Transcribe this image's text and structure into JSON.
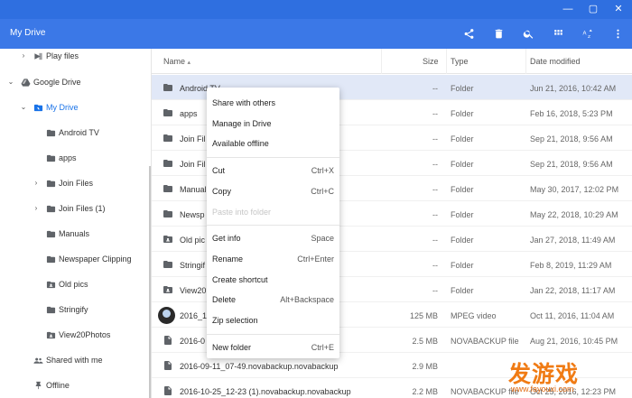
{
  "window": {
    "controls": [
      {
        "name": "minimize-button",
        "glyph": "—"
      },
      {
        "name": "maximize-button",
        "glyph": "▢"
      },
      {
        "name": "close-button",
        "glyph": "✕"
      }
    ]
  },
  "appbar": {
    "title": "My Drive",
    "icons": [
      "share-icon",
      "delete-icon",
      "search-icon",
      "grid-view-icon",
      "sort-az-icon",
      "more-vert-icon"
    ],
    "background": "#3b78e7"
  },
  "sidebar": {
    "items": [
      {
        "label": "Play files",
        "icon": "play-files-icon",
        "chevron": "›",
        "name": "sidebar-item-play-files"
      },
      {
        "label": "Google Drive",
        "icon": "google-drive-icon",
        "chevron": "⌄",
        "name": "sidebar-item-google-drive"
      },
      {
        "label": "My Drive",
        "icon": "my-drive-icon",
        "chevron": "⌄",
        "name": "sidebar-item-my-drive",
        "selected": true
      },
      {
        "label": "Android TV",
        "icon": "folder-icon",
        "chevron": "",
        "name": "sidebar-item-android-tv"
      },
      {
        "label": "apps",
        "icon": "folder-icon",
        "chevron": "",
        "name": "sidebar-item-apps"
      },
      {
        "label": "Join Files",
        "icon": "folder-icon",
        "chevron": "›",
        "name": "sidebar-item-join-files"
      },
      {
        "label": "Join Files (1)",
        "icon": "folder-icon",
        "chevron": "›",
        "name": "sidebar-item-join-files-1"
      },
      {
        "label": "Manuals",
        "icon": "folder-icon",
        "chevron": "",
        "name": "sidebar-item-manuals"
      },
      {
        "label": "Newspaper Clipping",
        "icon": "folder-icon",
        "chevron": "",
        "name": "sidebar-item-newspaper-clipping"
      },
      {
        "label": "Old pics",
        "icon": "shared-folder-icon",
        "chevron": "",
        "name": "sidebar-item-old-pics"
      },
      {
        "label": "Stringify",
        "icon": "folder-icon",
        "chevron": "",
        "name": "sidebar-item-stringify"
      },
      {
        "label": "View20Photos",
        "icon": "shared-folder-icon",
        "chevron": "",
        "name": "sidebar-item-view20photos"
      },
      {
        "label": "Shared with me",
        "icon": "shared-with-me-icon",
        "chevron": "",
        "name": "sidebar-item-shared-with-me"
      },
      {
        "label": "Offline",
        "icon": "offline-pin-icon",
        "chevron": "",
        "name": "sidebar-item-offline"
      }
    ]
  },
  "columns": {
    "name": "Name",
    "name_sort": "▴",
    "size": "Size",
    "type": "Type",
    "date": "Date modified"
  },
  "files": [
    {
      "name": "Android TV",
      "size": "--",
      "type": "Folder",
      "date": "Jun 21, 2016, 10:42 AM",
      "icon": "folder-icon",
      "selected": true
    },
    {
      "name": "apps",
      "size": "--",
      "type": "Folder",
      "date": "Feb 16, 2018, 5:23 PM",
      "icon": "folder-icon"
    },
    {
      "name": "Join Fil",
      "size": "--",
      "type": "Folder",
      "date": "Sep 21, 2018, 9:56 AM",
      "icon": "folder-icon"
    },
    {
      "name": "Join Fil",
      "size": "--",
      "type": "Folder",
      "date": "Sep 21, 2018, 9:56 AM",
      "icon": "folder-icon"
    },
    {
      "name": "Manual",
      "size": "--",
      "type": "Folder",
      "date": "May 30, 2017, 12:02 PM",
      "icon": "folder-icon"
    },
    {
      "name": "Newsp",
      "size": "--",
      "type": "Folder",
      "date": "May 22, 2018, 10:29 AM",
      "icon": "folder-icon"
    },
    {
      "name": "Old pic",
      "size": "--",
      "type": "Folder",
      "date": "Jan 27, 2018, 11:49 AM",
      "icon": "shared-folder-icon"
    },
    {
      "name": "Stringif",
      "size": "--",
      "type": "Folder",
      "date": "Feb 8, 2019, 11:29 AM",
      "icon": "folder-icon"
    },
    {
      "name": "View20",
      "size": "--",
      "type": "Folder",
      "date": "Jan 22, 2018, 11:17 AM",
      "icon": "shared-folder-icon"
    },
    {
      "name": "2016_1",
      "size": "125 MB",
      "type": "MPEG video",
      "date": "Oct 11, 2016, 11:04 AM",
      "icon": "video-thumbnail"
    },
    {
      "name": "2016-0",
      "size": "2.5 MB",
      "type": "NOVABACKUP file",
      "date": "Aug 21, 2016, 10:45 PM",
      "icon": "file-icon"
    },
    {
      "name": "2016-09-11_07-49.novabackup.novabackup",
      "size": "2.9 MB",
      "type": "",
      "date": "",
      "icon": "file-icon"
    },
    {
      "name": "2016-10-25_12-23 (1).novabackup.novabackup",
      "size": "2.2 MB",
      "type": "NOVABACKUP file",
      "date": "Oct 25, 2016, 12:23 PM",
      "icon": "file-icon"
    }
  ],
  "context_menu": {
    "groups": [
      [
        {
          "label": "Share with others",
          "shortcut": "",
          "name": "menu-share-with-others"
        },
        {
          "label": "Manage in Drive",
          "shortcut": "",
          "name": "menu-manage-in-drive"
        },
        {
          "label": "Available offline",
          "shortcut": "",
          "name": "menu-available-offline"
        }
      ],
      [
        {
          "label": "Cut",
          "shortcut": "Ctrl+X",
          "name": "menu-cut"
        },
        {
          "label": "Copy",
          "shortcut": "Ctrl+C",
          "name": "menu-copy"
        },
        {
          "label": "Paste into folder",
          "shortcut": "",
          "name": "menu-paste-into-folder",
          "disabled": true
        }
      ],
      [
        {
          "label": "Get info",
          "shortcut": "Space",
          "name": "menu-get-info"
        },
        {
          "label": "Rename",
          "shortcut": "Ctrl+Enter",
          "name": "menu-rename"
        },
        {
          "label": "Create shortcut",
          "shortcut": "",
          "name": "menu-create-shortcut"
        },
        {
          "label": "Delete",
          "shortcut": "Alt+Backspace",
          "name": "menu-delete"
        },
        {
          "label": "Zip selection",
          "shortcut": "",
          "name": "menu-zip-selection"
        }
      ],
      [
        {
          "label": "New folder",
          "shortcut": "Ctrl+E",
          "name": "menu-new-folder"
        }
      ]
    ]
  },
  "watermark": {
    "big": "发游戏",
    "small": "www.fayouxi.com"
  },
  "colors": {
    "accent": "#1a73e8",
    "titlebar": "#2f6fe0",
    "selected_row": "#e1e8f7",
    "watermark": "#f07b14"
  }
}
